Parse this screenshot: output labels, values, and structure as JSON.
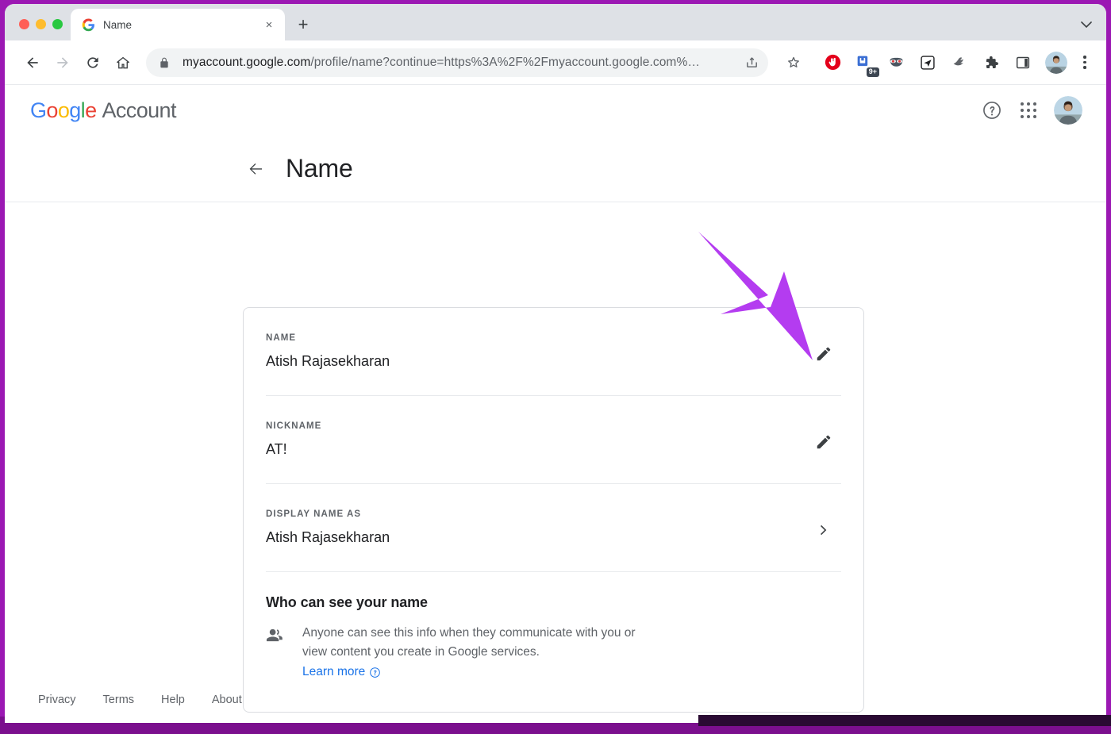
{
  "browser": {
    "tab": {
      "title": "Name",
      "favicon": "google-g-icon",
      "close_label": "×"
    },
    "new_tab_label": "+",
    "window_chevron": "chevron-down-icon",
    "nav": {
      "back": "back-arrow-icon",
      "forward": "forward-arrow-icon",
      "reload": "reload-icon",
      "home": "home-icon"
    },
    "omnibox": {
      "lock": "lock-icon",
      "url_domain": "myaccount.google.com",
      "url_path": "/profile/name?continue=https%3A%2F%2Fmyaccount.google.com%…",
      "share": "share-icon",
      "bookmark": "star-icon"
    },
    "extensions": [
      {
        "name": "adblock-icon",
        "badge": ""
      },
      {
        "name": "pocket-save-icon",
        "badge": "9+"
      },
      {
        "name": "emoji-mask-icon",
        "badge": ""
      },
      {
        "name": "send-arrow-icon",
        "badge": ""
      },
      {
        "name": "bird-icon",
        "badge": ""
      },
      {
        "name": "puzzle-extensions-icon",
        "badge": ""
      },
      {
        "name": "side-panel-icon",
        "badge": ""
      }
    ],
    "profile_avatar": "user-avatar",
    "menu": "three-dot-menu-icon"
  },
  "app_header": {
    "logo_google": "Google",
    "logo_product": "Account",
    "help_icon": "help-circle-icon",
    "apps_icon": "apps-grid-icon",
    "avatar": "account-avatar"
  },
  "page": {
    "back_icon": "back-arrow-icon",
    "title": "Name"
  },
  "card": {
    "rows": [
      {
        "label": "NAME",
        "value": "Atish Rajasekharan",
        "action": "edit-pencil-icon"
      },
      {
        "label": "NICKNAME",
        "value": "AT!",
        "action": "edit-pencil-icon"
      },
      {
        "label": "DISPLAY NAME AS",
        "value": "Atish Rajasekharan",
        "action": "chevron-right-icon"
      }
    ],
    "privacy": {
      "heading": "Who can see your name",
      "icon": "people-icon",
      "text": "Anyone can see this info when they communicate with you or view content you create in Google services.",
      "learn_more": "Learn more",
      "learn_more_icon": "help-circle-icon"
    }
  },
  "footer": {
    "links": [
      "Privacy",
      "Terms",
      "Help",
      "About"
    ]
  },
  "annotation": {
    "arrow_color": "#b43cf0",
    "frame_color": "#9b18b3",
    "points_to": "edit-pencil-icon"
  }
}
